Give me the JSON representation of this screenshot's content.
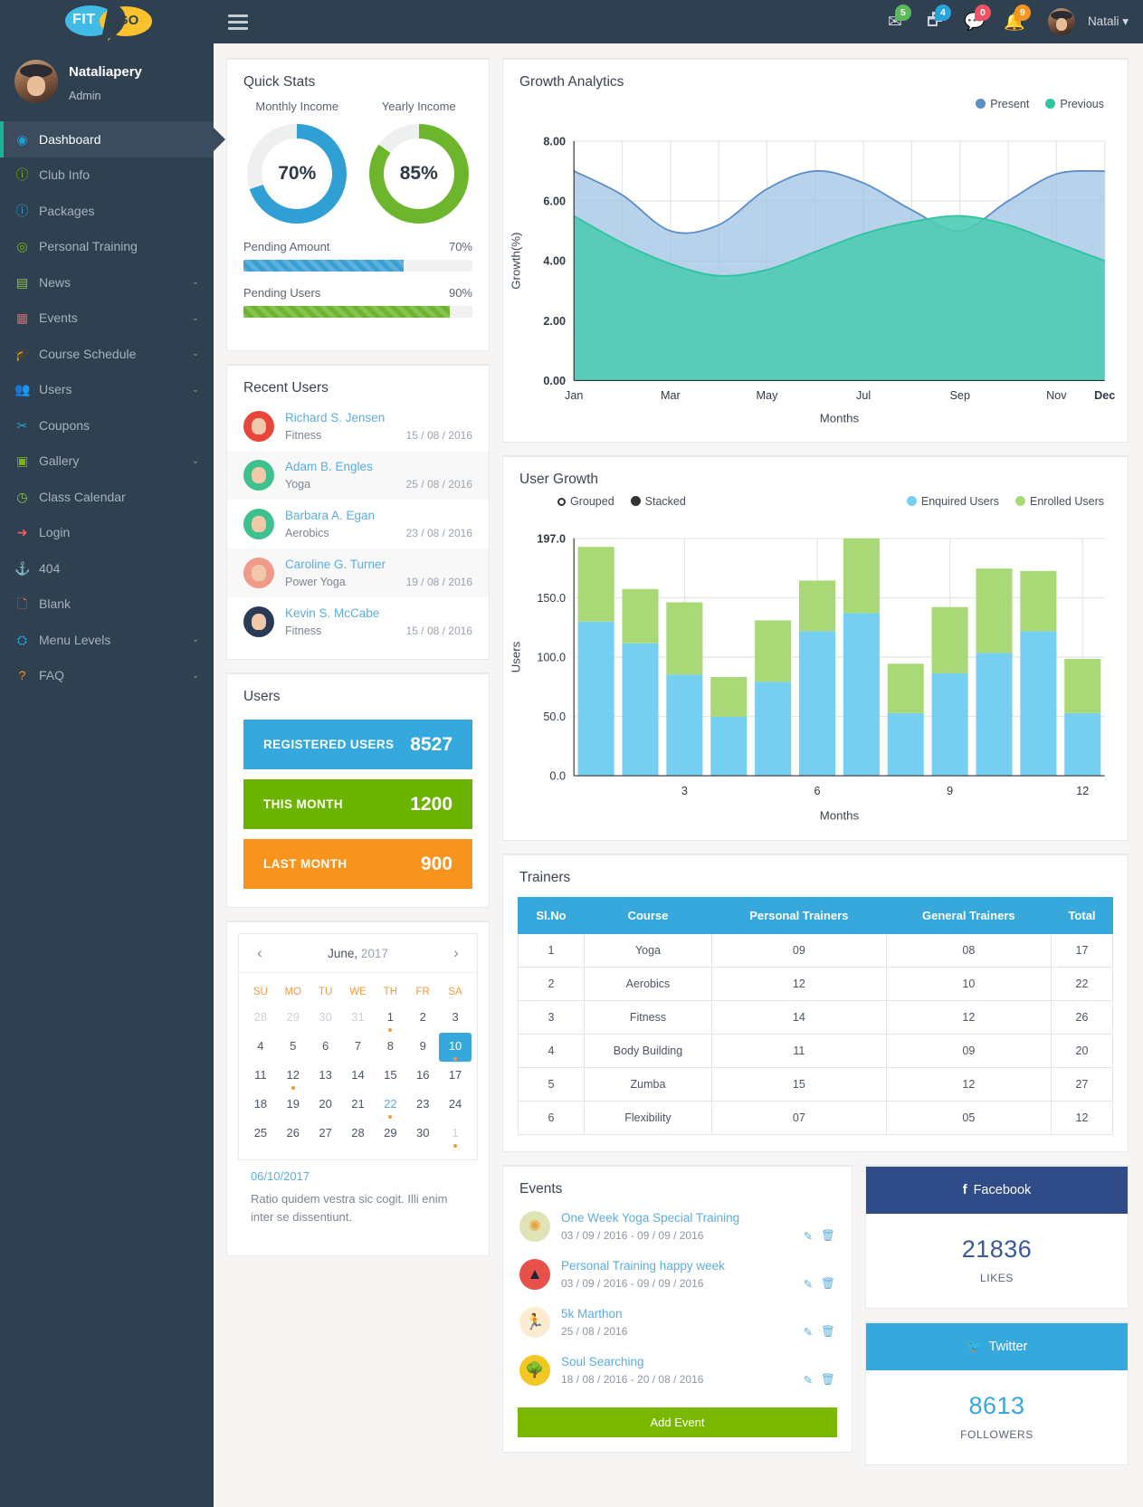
{
  "brand": {
    "fit": "FIT",
    "go": "GO"
  },
  "profile": {
    "name": "Nataliapery",
    "role": "Admin"
  },
  "topbar": {
    "user": "Natali",
    "caret": "▾",
    "icons": [
      {
        "name": "mail-icon",
        "glyph": "✉",
        "badge": "5",
        "color": "green"
      },
      {
        "name": "tasks-icon",
        "glyph": "🗗",
        "badge": "4",
        "color": "blue"
      },
      {
        "name": "chat-icon",
        "glyph": "💬",
        "badge": "0",
        "color": "red"
      },
      {
        "name": "bell-icon",
        "glyph": "🔔",
        "badge": "9",
        "color": "orange"
      }
    ]
  },
  "sidebar": {
    "items": [
      {
        "label": "Dashboard",
        "icon": "◉",
        "color": "#1c9fd8",
        "caret": "",
        "active": true
      },
      {
        "label": "Club Info",
        "icon": "ⓘ",
        "color": "#7ab800",
        "caret": ""
      },
      {
        "label": "Packages",
        "icon": "ⓘ",
        "color": "#2d9fd9",
        "caret": ""
      },
      {
        "label": "Personal Training",
        "icon": "◎",
        "color": "#7ab800",
        "caret": ""
      },
      {
        "label": "News",
        "icon": "▤",
        "color": "#8cc63e",
        "caret": "⌄"
      },
      {
        "label": "Events",
        "icon": "▦",
        "color": "#ef5f5f",
        "caret": "⌄"
      },
      {
        "label": "Course Schedule",
        "icon": "🎓",
        "color": "#f7941e",
        "caret": "⌄"
      },
      {
        "label": "Users",
        "icon": "👥",
        "color": "#ffffff",
        "caret": "⌄"
      },
      {
        "label": "Coupons",
        "icon": "✂",
        "color": "#2d9fd9",
        "caret": ""
      },
      {
        "label": "Gallery",
        "icon": "▣",
        "color": "#7ab800",
        "caret": "⌄"
      },
      {
        "label": "Class Calendar",
        "icon": "◷",
        "color": "#8cc63e",
        "caret": ""
      },
      {
        "label": "Login",
        "icon": "➜",
        "color": "#ef5f5f",
        "caret": ""
      },
      {
        "label": "404",
        "icon": "⚓",
        "color": "#f7941e",
        "caret": ""
      },
      {
        "label": "Blank",
        "icon": "🗋",
        "color": "#ef5f5f",
        "caret": ""
      },
      {
        "label": "Menu Levels",
        "icon": "⛭",
        "color": "#2d9fd9",
        "caret": "⌄"
      },
      {
        "label": "FAQ",
        "icon": "?",
        "color": "#f7941e",
        "caret": "⌄"
      }
    ]
  },
  "quick_stats": {
    "title": "Quick Stats",
    "donuts": [
      {
        "caption": "Monthly Income",
        "value": "70%",
        "percent": 70,
        "color": "#2f9fd4"
      },
      {
        "caption": "Yearly Income",
        "value": "85%",
        "percent": 85,
        "color": "#6cb52d"
      }
    ],
    "progress": [
      {
        "label": "Pending Amount",
        "value": "70%",
        "percent": 70,
        "color": "#3aa0d4"
      },
      {
        "label": "Pending Users",
        "value": "90%",
        "percent": 90,
        "color": "#6cb52d"
      }
    ]
  },
  "recent_users": {
    "title": "Recent Users",
    "rows": [
      {
        "name": "Richard S. Jensen",
        "course": "Fitness",
        "date": "15 / 08 / 2016",
        "av": "#e8453c"
      },
      {
        "name": "Adam B. Engles",
        "course": "Yoga",
        "date": "25 / 08 / 2016",
        "av": "#3fc08f"
      },
      {
        "name": "Barbara A. Egan",
        "course": "Aerobics",
        "date": "23 / 08 / 2016",
        "av": "#3fc08f"
      },
      {
        "name": "Caroline G. Turner",
        "course": "Power Yoga",
        "date": "19 / 08 / 2016",
        "av": "#ef9a8a"
      },
      {
        "name": "Kevin S. McCabe",
        "course": "Fitness",
        "date": "15 / 08 / 2016",
        "av": "#2b3a55"
      }
    ]
  },
  "users_card": {
    "title": "Users",
    "bars": [
      {
        "label": "REGISTERED USERS",
        "value": "8527",
        "color": "#35a8dd"
      },
      {
        "label": "THIS MONTH",
        "value": "1200",
        "color": "#6cb300"
      },
      {
        "label": "LAST MONTH",
        "value": "900",
        "color": "#f7941e"
      }
    ]
  },
  "calendar": {
    "month": "June,",
    "year": "2017",
    "prev": "‹",
    "next": "›",
    "dow": [
      "SU",
      "MO",
      "TU",
      "WE",
      "TH",
      "FR",
      "SA"
    ],
    "weeks": [
      [
        {
          "d": "28",
          "m": true
        },
        {
          "d": "29",
          "m": true
        },
        {
          "d": "30",
          "m": true
        },
        {
          "d": "31",
          "m": true
        },
        {
          "d": "1",
          "dot": true
        },
        {
          "d": "2"
        },
        {
          "d": "3"
        }
      ],
      [
        {
          "d": "4"
        },
        {
          "d": "5"
        },
        {
          "d": "6"
        },
        {
          "d": "7"
        },
        {
          "d": "8"
        },
        {
          "d": "9"
        },
        {
          "d": "10",
          "sel": true,
          "dot": true
        }
      ],
      [
        {
          "d": "11"
        },
        {
          "d": "12",
          "dot": true
        },
        {
          "d": "13"
        },
        {
          "d": "14"
        },
        {
          "d": "15"
        },
        {
          "d": "16"
        },
        {
          "d": "17"
        }
      ],
      [
        {
          "d": "18"
        },
        {
          "d": "19"
        },
        {
          "d": "20"
        },
        {
          "d": "21"
        },
        {
          "d": "22",
          "hl": true,
          "dot": true
        },
        {
          "d": "23"
        },
        {
          "d": "24"
        }
      ],
      [
        {
          "d": "25"
        },
        {
          "d": "26"
        },
        {
          "d": "27"
        },
        {
          "d": "28"
        },
        {
          "d": "29"
        },
        {
          "d": "30"
        },
        {
          "d": "1",
          "m": true,
          "dot": true
        }
      ]
    ],
    "note_date": "06/10/2017",
    "note_text": "Ratio quidem vestra sic cogit. Illi enim inter se dissentiunt."
  },
  "trainers": {
    "title": "Trainers",
    "columns": [
      "Sl.No",
      "Course",
      "Personal Trainers",
      "General Trainers",
      "Total"
    ],
    "rows": [
      [
        "1",
        "Yoga",
        "09",
        "08",
        "17"
      ],
      [
        "2",
        "Aerobics",
        "12",
        "10",
        "22"
      ],
      [
        "3",
        "Fitness",
        "14",
        "12",
        "26"
      ],
      [
        "4",
        "Body Building",
        "11",
        "09",
        "20"
      ],
      [
        "5",
        "Zumba",
        "15",
        "12",
        "27"
      ],
      [
        "6",
        "Flexibility",
        "07",
        "05",
        "12"
      ]
    ]
  },
  "events": {
    "title": "Events",
    "add_label": "Add Event",
    "edit_glyph": "✎",
    "delete_glyph": "🗑",
    "rows": [
      {
        "name": "One Week Yoga Special Training",
        "date": "03 / 09 / 2016 - 09 / 09 / 2016",
        "icon": "✺",
        "bg": "#dfe3b6",
        "fg": "#e8a33d"
      },
      {
        "name": "Personal Training happy week",
        "date": "03 / 09 / 2016 - 09 / 09 / 2016",
        "icon": "▲",
        "bg": "#e8504a",
        "fg": "#1b2440"
      },
      {
        "name": "5k Marthon",
        "date": "25 / 08 / 2016",
        "icon": "🏃",
        "bg": "#fdebd0",
        "fg": "#d9534f"
      },
      {
        "name": "Soul Searching",
        "date": "18 / 08 / 2016 - 20 / 08 / 2016",
        "icon": "🌳",
        "bg": "#f2c623",
        "fg": "#4a7c24"
      }
    ]
  },
  "social": [
    {
      "network": "Facebook",
      "icon": "f",
      "head_bg": "#2f4b88",
      "value": "21836",
      "caption": "LIKES",
      "value_color": "#3b5998"
    },
    {
      "network": "Twitter",
      "icon": "🐦",
      "head_bg": "#35a8dd",
      "value": "8613",
      "caption": "FOLLOWERS",
      "value_color": "#35a8dd"
    }
  ],
  "chart_data": [
    {
      "type": "area",
      "title": "Growth Analytics",
      "xlabel": "Months",
      "ylabel": "Growth(%)",
      "ylim": [
        0,
        8
      ],
      "yticks": [
        "0.00",
        "2.00",
        "4.00",
        "6.00",
        "8.00"
      ],
      "x": [
        "Jan",
        "Feb",
        "Mar",
        "Apr",
        "May",
        "Jun",
        "Jul",
        "Aug",
        "Sep",
        "Oct",
        "Nov",
        "Dec"
      ],
      "xticks": [
        "Jan",
        "Mar",
        "May",
        "Jul",
        "Sep",
        "Nov",
        "Dec"
      ],
      "legend": [
        "Present",
        "Previous"
      ],
      "legend_position": "top-right",
      "grid": true,
      "series": [
        {
          "name": "Present",
          "color": "#5d8fc4",
          "fill": "#9dc0e3",
          "values": [
            7.0,
            6.2,
            5.0,
            5.2,
            6.4,
            7.0,
            6.6,
            5.7,
            5.0,
            6.0,
            6.9,
            7.0
          ]
        },
        {
          "name": "Previous",
          "color": "#2ec4a0",
          "fill": "#4ecbb4",
          "values": [
            5.5,
            4.6,
            3.9,
            3.5,
            3.7,
            4.3,
            4.9,
            5.3,
            5.5,
            5.2,
            4.6,
            4.0
          ]
        }
      ]
    },
    {
      "type": "bar",
      "title": "User Growth",
      "xlabel": "Months",
      "ylabel": "Users",
      "ylim": [
        0,
        197
      ],
      "yticks": [
        "0.0",
        "50.0",
        "100.0",
        "150.0",
        "197.0"
      ],
      "categories": [
        "1",
        "2",
        "3",
        "4",
        "5",
        "6",
        "7",
        "8",
        "9",
        "10",
        "11",
        "12"
      ],
      "xticks": [
        "3",
        "6",
        "9",
        "12"
      ],
      "mode": "Stacked",
      "mode_options": [
        "Grouped",
        "Stacked"
      ],
      "legend": [
        "Enquired Users",
        "Enrolled Users"
      ],
      "grid": true,
      "series": [
        {
          "name": "Enquired Users",
          "color": "#76cef0",
          "values": [
            128,
            110,
            84,
            49,
            78,
            120,
            135,
            52,
            85,
            102,
            120,
            52
          ]
        },
        {
          "name": "Enrolled Users",
          "color": "#a9d976",
          "values": [
            62,
            45,
            60,
            33,
            51,
            42,
            62,
            41,
            55,
            70,
            50,
            45
          ]
        }
      ]
    }
  ]
}
